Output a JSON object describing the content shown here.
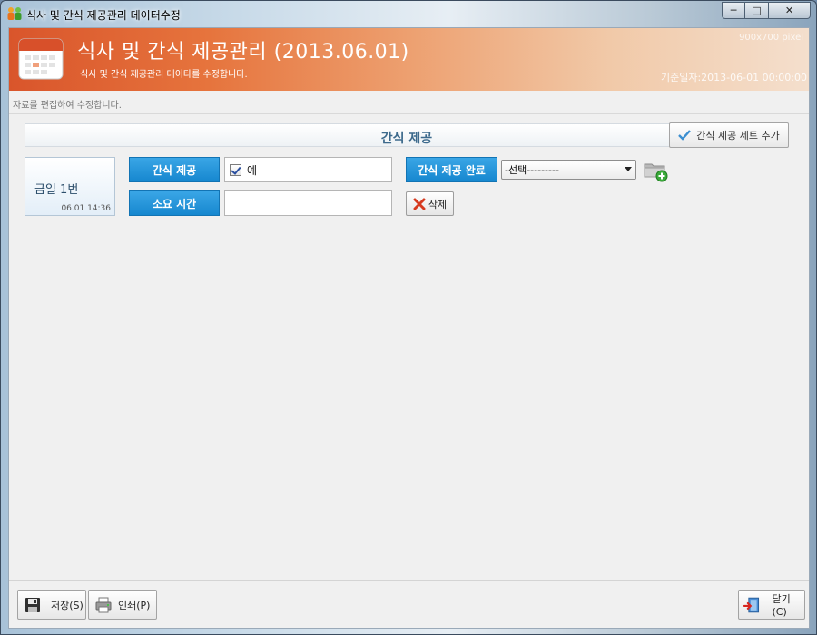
{
  "window": {
    "title": "식사 및 간식 제공관리 데이터수정",
    "minimize_label": "─",
    "maximize_label": "□",
    "close_label": "✕"
  },
  "header": {
    "title": "식사 및 간식 제공관리 (2013.06.01)",
    "subtitle": "식사 및 간식 제공관리 데이타를 수정합니다.",
    "dimension_text": "900x700 pixel",
    "base_date": "기준일자:2013-06-01 00:00:00"
  },
  "hint": "자료를 편집하여 수정합니다.",
  "section": {
    "title": "간식 제공",
    "add_set_label": "간식 제공 세트 추가"
  },
  "day_card": {
    "name": "금일 1번",
    "time": "06.01 14:36"
  },
  "form": {
    "snack_label": "간식 제공",
    "snack_checked": true,
    "snack_value": "예",
    "duration_label": "소요 시간",
    "duration_value": "",
    "complete_label": "간식 제공 완료",
    "complete_selected": "-선택---------",
    "delete_label": "삭제"
  },
  "footer": {
    "save_label": "저장(S)",
    "print_label": "인쇄(P)",
    "close_label": "닫기(C)"
  }
}
